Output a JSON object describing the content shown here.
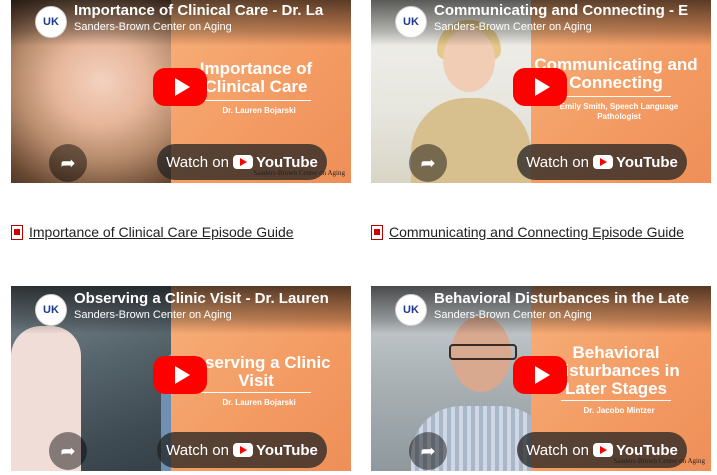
{
  "channel": "Sanders-Brown Center on Aging",
  "logo_text": "UK",
  "watch_label": "Watch on",
  "youtube_label": "YouTube",
  "watermark": "Sanders-Brown Center on Aging",
  "videos": [
    {
      "title": "Importance of Clinical Care - Dr. La",
      "overlay_title": "Importance of Clinical Care",
      "overlay_sub": "Dr. Lauren Bojarski"
    },
    {
      "title": "Communicating and Connecting - E",
      "overlay_title": "Communicating and Connecting",
      "overlay_sub": "Emily Smith, Speech Language Pathologist"
    },
    {
      "title": "Observing a Clinic Visit - Dr. Lauren",
      "overlay_title": "Observing a Clinic Visit",
      "overlay_sub": "Dr. Lauren Bojarski"
    },
    {
      "title": "Behavioral Disturbances in the Late",
      "overlay_title": "Behavioral Disturbances in Later Stages",
      "overlay_sub": "Dr. Jacobo Mintzer"
    }
  ],
  "guides": [
    {
      "label": "Importance of Clinical Care Episode Guide"
    },
    {
      "label": "Communicating and Connecting Episode Guide"
    }
  ],
  "colors": {
    "accent_orange": "#f39a62",
    "play_red": "#ff0000"
  },
  "icons": {
    "share": "share-icon",
    "pdf": "pdf-icon",
    "play": "play-icon"
  }
}
